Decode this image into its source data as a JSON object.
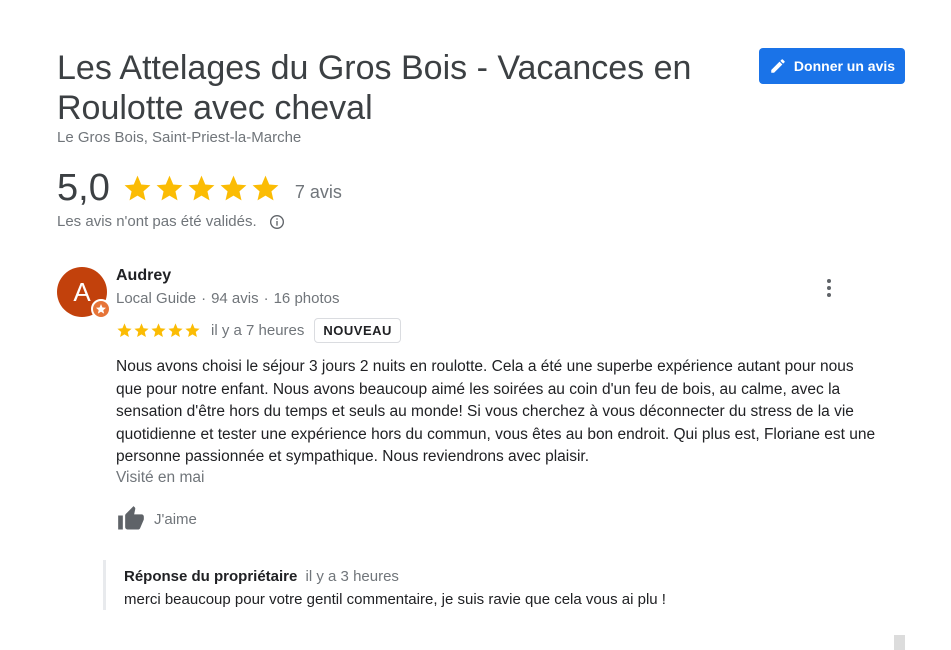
{
  "place": {
    "title": "Les Attelages du Gros Bois - Vacances en Roulotte avec cheval",
    "location": "Le Gros Bois, Saint-Priest-la-Marche",
    "rating": "5,0",
    "stars": 5,
    "review_count": "7 avis",
    "notice": "Les avis n'ont pas été validés."
  },
  "actions": {
    "write_review_label": "Donner un avis"
  },
  "review": {
    "avatar_letter": "A",
    "author": "Audrey",
    "role": "Local Guide",
    "reviews_count": "94 avis",
    "photos_count": "16 photos",
    "stars": 5,
    "time": "il y a 7 heures",
    "badge": "NOUVEAU",
    "text": "Nous avons choisi le séjour 3 jours 2 nuits en roulotte. Cela a été une superbe expérience autant pour nous que pour notre enfant. Nous avons beaucoup aimé les soirées au coin d'un feu de bois, au calme, avec la sensation d'être hors du temps et seuls au monde! Si vous cherchez à vous déconnecter du stress de la vie quotidienne et tester une expérience hors du commun, vous êtes au bon endroit. Qui plus est, Floriane est une personne passionnée et sympathique. Nous reviendrons avec plaisir.",
    "visited": "Visité en mai",
    "like_label": "J'aime"
  },
  "owner_reply": {
    "title": "Réponse du propriétaire",
    "time": "il y a 3 heures",
    "text": "merci beaucoup pour votre gentil commentaire, je suis ravie que cela vous ai plu !"
  },
  "colors": {
    "accent": "#1a73e8",
    "star": "#fbbc04",
    "muted_text": "#70757a",
    "avatar_bg": "#c2410c"
  }
}
